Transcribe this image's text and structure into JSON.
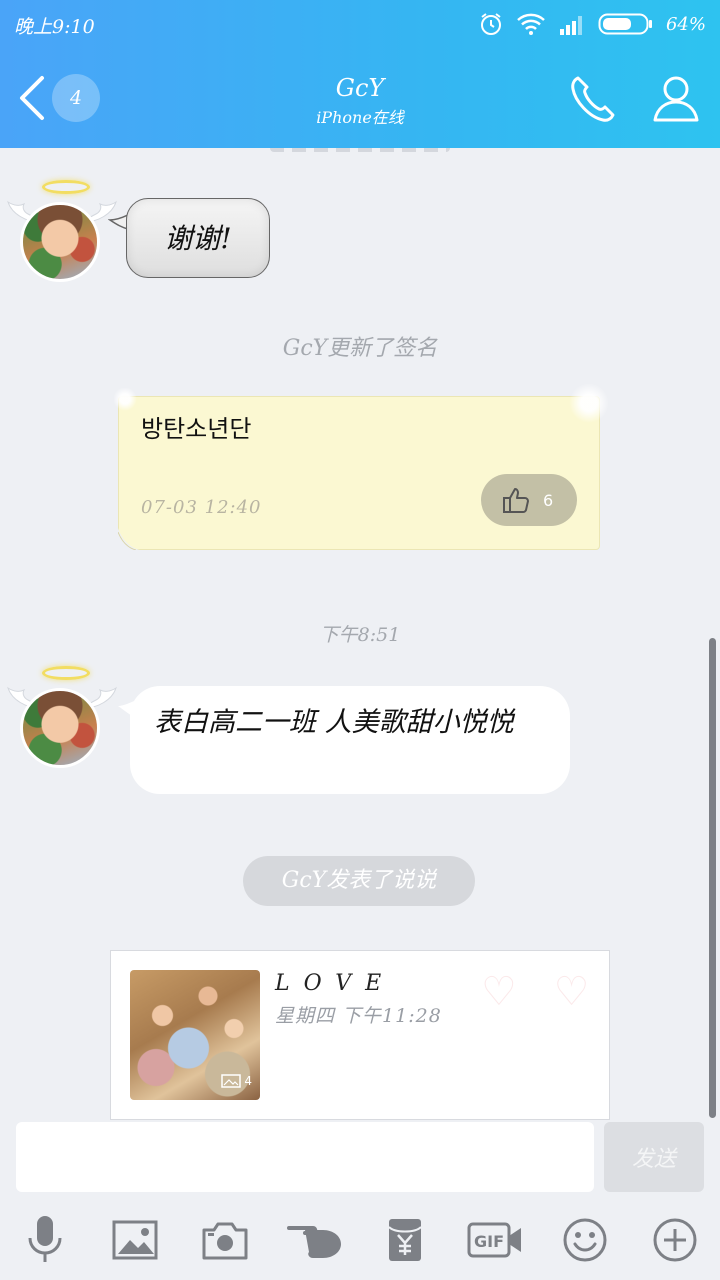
{
  "status_bar": {
    "time": "晚上9:10",
    "battery": "64%",
    "icons": [
      "alarm-icon",
      "wifi-icon",
      "signal-icon",
      "battery-icon"
    ]
  },
  "header": {
    "unread_count": "4",
    "contact_name": "GcY",
    "contact_status": "iPhone在线",
    "icons": [
      "back-arrow-icon",
      "phone-icon",
      "profile-icon"
    ]
  },
  "chat": {
    "msg1": {
      "text": "谢谢!"
    },
    "signature_notice": "GcY更新了签名",
    "signature_card": {
      "text": "방탄소년단",
      "time": "07-03  12:40",
      "likes": "6"
    },
    "timestamp": "下午8:51",
    "msg2": {
      "text": "表白高二一班  人美歌甜小悦悦"
    },
    "post_notice": "GcY发表了说说",
    "post_card": {
      "title": "LOVE",
      "time": "星期四  下午11:28",
      "photo_count": "4"
    }
  },
  "input": {
    "placeholder": "",
    "send_label": "发送"
  },
  "toolbar": {
    "icons": [
      "microphone-icon",
      "image-icon",
      "camera-icon",
      "poke-icon",
      "red-packet-icon",
      "gif-icon",
      "emoji-icon",
      "plus-icon"
    ]
  },
  "colors": {
    "header_start": "#4aa4f8",
    "header_end": "#2ec3f0",
    "background": "#eef0f4",
    "signature_card": "#fbf8d2",
    "like_button": "#c3c0a6"
  }
}
